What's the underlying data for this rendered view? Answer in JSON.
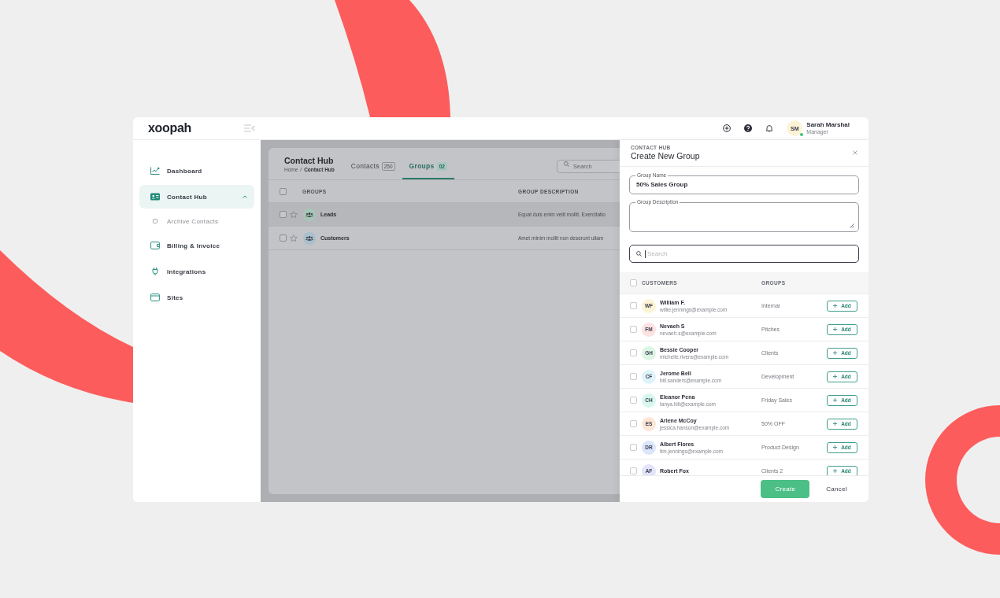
{
  "topbar": {
    "logo": "xoopah",
    "user": {
      "initials": "SM",
      "name": "Sarah Marshal",
      "role": "Manager",
      "online": true
    }
  },
  "sidebar": {
    "items": [
      {
        "label": "Dashboard",
        "selected": false
      },
      {
        "label": "Contact Hub",
        "selected": true,
        "expanded": true,
        "children": [
          {
            "label": "Archive Contacts",
            "selected": false
          }
        ]
      },
      {
        "label": "Billing & Invoice",
        "selected": false
      },
      {
        "label": "Integrations",
        "selected": false
      },
      {
        "label": "Sites",
        "selected": false
      }
    ]
  },
  "page": {
    "title": "Contact Hub",
    "breadcrumb": [
      "Home",
      "Contact Hub"
    ],
    "breadcrumb_separator": "/",
    "tabs": [
      {
        "label": "Contacts",
        "count": "250",
        "selected": false
      },
      {
        "label": "Groups",
        "count": "02",
        "selected": true
      }
    ],
    "search": {
      "placeholder": "Search"
    },
    "table": {
      "columns": [
        "GROUPS",
        "GROUP DESCRIPTION"
      ],
      "header_checked": false,
      "rows": [
        {
          "name": "Leads",
          "description": "Equat duis enim velit mollit. Exercitatio",
          "checked": false,
          "starred": false,
          "selected": true,
          "color": "#a6c6b6"
        },
        {
          "name": "Customers",
          "description": "Amet minim mollit non deserunt ullam",
          "checked": false,
          "starred": false,
          "selected": false,
          "color": "#a8bfcd"
        }
      ]
    }
  },
  "drawer": {
    "eyebrow": "CONTACT HUB",
    "title": "Create New Group",
    "fields": [
      {
        "kind": "input",
        "label": "Group Name",
        "value": "50% Sales Group"
      },
      {
        "kind": "textarea",
        "label": "Group Description"
      }
    ],
    "search": {
      "placeholder": "Search",
      "focused": true
    },
    "table": {
      "columns": [
        "CUSTOMERS",
        "GROUPS"
      ],
      "header_checked": false,
      "rows": [
        {
          "initials": "WF",
          "name": "William F.",
          "email": "willie.jennings@example.com",
          "group": "Internal",
          "color": "#fdf4d6",
          "checked": false,
          "action": "Add"
        },
        {
          "initials": "FM",
          "name": "Nevaeh S",
          "email": "nevaeh.s@example.com",
          "group": "Pitches",
          "color": "#fde2e2",
          "checked": false,
          "action": "Add"
        },
        {
          "initials": "GH",
          "name": "Bessie Cooper",
          "email": "michelle.rivera@example.com",
          "group": "Clients",
          "color": "#dcf5e4",
          "checked": false,
          "action": "Add"
        },
        {
          "initials": "CF",
          "name": "Jerome Bell",
          "email": "bill.sanders@example.com",
          "group": "Development",
          "color": "#dff3fb",
          "checked": false,
          "action": "Add"
        },
        {
          "initials": "CH",
          "name": "Eleanor Pena",
          "email": "tanya.hill@example.com",
          "group": "Friday Sales",
          "color": "#d7f7ee",
          "checked": false,
          "action": "Add"
        },
        {
          "initials": "ES",
          "name": "Arlene McCoy",
          "email": "jessica.hanson@example.com",
          "group": "50% OFF",
          "color": "#fde6d6",
          "checked": false,
          "action": "Add"
        },
        {
          "initials": "DR",
          "name": "Albert Flores",
          "email": "tim.jennings@example.com",
          "group": "Product Design",
          "color": "#dbe5fc",
          "checked": false,
          "action": "Add"
        },
        {
          "initials": "AF",
          "name": "Robert Fox",
          "group": "Clients 2",
          "color": "#e3e3fb",
          "checked": false,
          "action": "Add"
        }
      ]
    },
    "buttons": [
      {
        "label": "Create",
        "kind": "primary"
      },
      {
        "label": "Cancel",
        "kind": "text"
      }
    ]
  }
}
